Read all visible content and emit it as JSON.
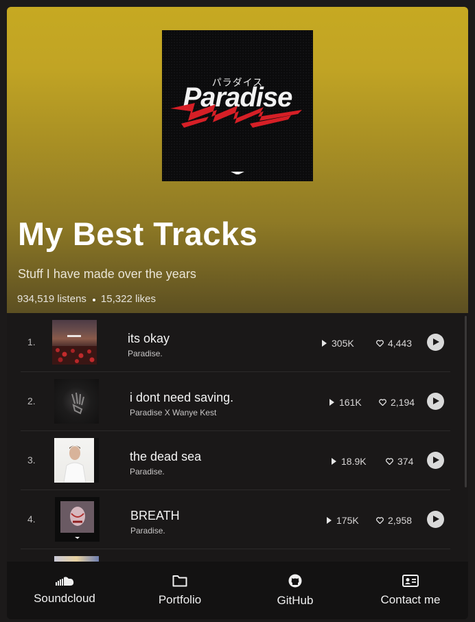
{
  "playlist": {
    "cover_text_jp": "パラダイス",
    "cover_text": "Paradise",
    "title": "My Best Tracks",
    "subtitle": "Stuff I have made over the years",
    "listens": "934,519 listens",
    "likes": "15,322 likes"
  },
  "tracks": [
    {
      "num": "1.",
      "name": "its okay",
      "artist": "Paradise.",
      "plays": "305K",
      "likes": "4,443"
    },
    {
      "num": "2.",
      "name": "i dont need saving.",
      "artist": "Paradise X Wanye Kest",
      "plays": "161K",
      "likes": "2,194"
    },
    {
      "num": "3.",
      "name": "the dead sea",
      "artist": "Paradise.",
      "plays": "18.9K",
      "likes": "374"
    },
    {
      "num": "4.",
      "name": "BREATH",
      "artist": "Paradise.",
      "plays": "175K",
      "likes": "2,958"
    }
  ],
  "nav": [
    {
      "label": "Soundcloud",
      "icon": "cloud-icon"
    },
    {
      "label": "Portfolio",
      "icon": "folder-icon"
    },
    {
      "label": "GitHub",
      "icon": "github-icon"
    },
    {
      "label": "Contact me",
      "icon": "id-card-icon"
    }
  ],
  "colors": {
    "header_top": "#c6a922",
    "background": "#1c1a1a",
    "accent_red": "#d61f26"
  }
}
